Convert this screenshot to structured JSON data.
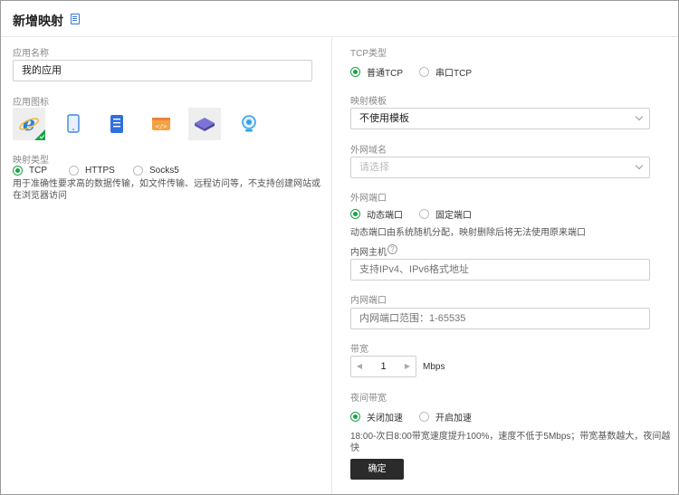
{
  "header": {
    "title": "新增映射"
  },
  "left": {
    "app_name_label": "应用名称",
    "app_name_value": "我的应用",
    "app_icon_label": "应用图标",
    "mapping_type_label": "映射类型",
    "mapping_types": [
      {
        "label": "TCP",
        "selected": true
      },
      {
        "label": "HTTPS",
        "selected": false
      },
      {
        "label": "Socks5",
        "selected": false
      }
    ],
    "mapping_desc": "用于准确性要求高的数据传输，如文件传输、远程访问等，不支持创建网站或在浏览器访问"
  },
  "right": {
    "tcp_type_label": "TCP类型",
    "tcp_types": [
      {
        "label": "普通TCP",
        "selected": true
      },
      {
        "label": "串口TCP",
        "selected": false
      }
    ],
    "template_label": "映射模板",
    "template_value": "不使用模板",
    "domain_label": "外网域名",
    "domain_placeholder": "请选择",
    "ext_port_label": "外网端口",
    "ext_port_types": [
      {
        "label": "动态端口",
        "selected": true
      },
      {
        "label": "固定端口",
        "selected": false
      }
    ],
    "ext_port_desc": "动态端口由系统随机分配，映射删除后将无法使用原来端口",
    "host_label": "内网主机",
    "host_placeholder": "支持IPv4、IPv6格式地址",
    "int_port_label": "内网端口",
    "int_port_placeholder": "内网端口范围：1-65535",
    "bandwidth_label": "带宽",
    "bandwidth_value": "1",
    "bandwidth_unit": "Mbps",
    "night_label": "夜间带宽",
    "night_options": [
      {
        "label": "关闭加速",
        "selected": true
      },
      {
        "label": "开启加速",
        "selected": false
      }
    ],
    "night_desc": "18:00-次日8:00带宽速度提升100%，速度不低于5Mbps；带宽基数越大，夜间越快",
    "confirm_label": "确定"
  },
  "colors": {
    "accent": "#1aa34a",
    "button_bg": "#2b2b2b",
    "link_icon": "#3a7bd5"
  }
}
